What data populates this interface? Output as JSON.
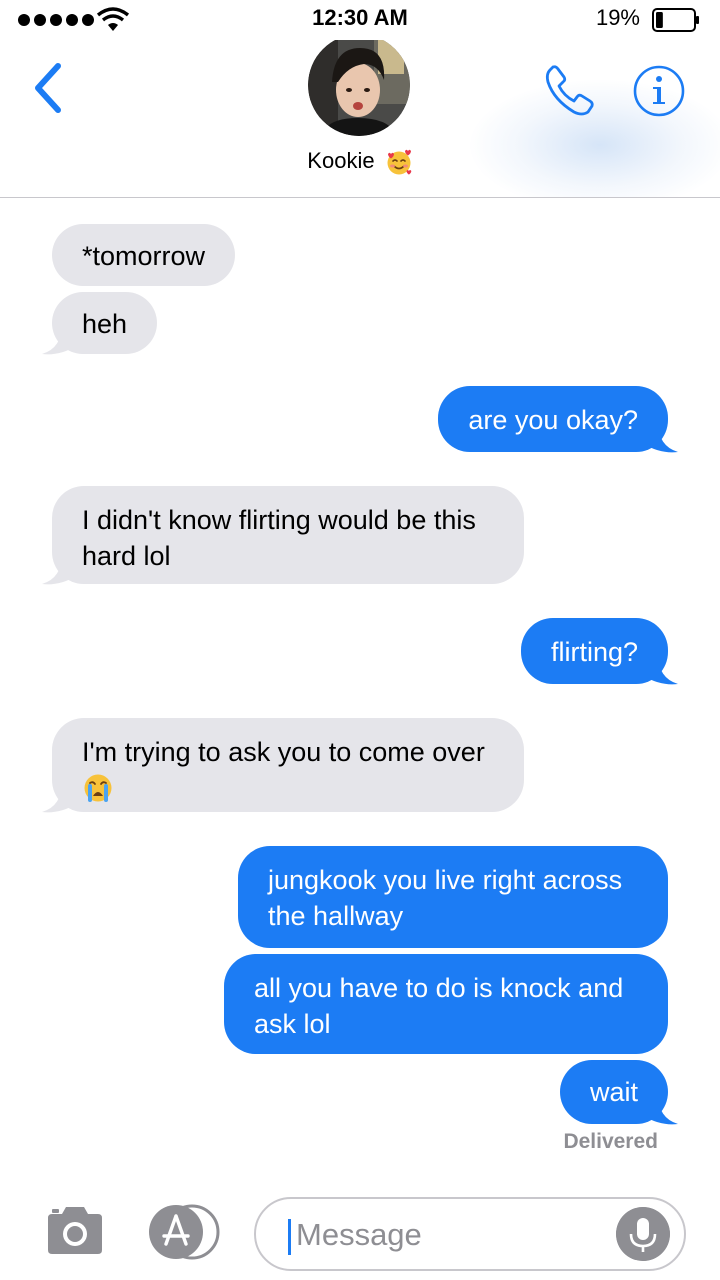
{
  "status_bar": {
    "time": "12:30 AM",
    "battery_percent": "19%",
    "battery_level": 0.19,
    "signal_bars": 5
  },
  "header": {
    "contact_name": "Kookie",
    "contact_emoji": "smiling-face-with-hearts-icon",
    "back_icon": "chevron-left-icon",
    "call_icon": "phone-icon",
    "info_icon": "info-icon"
  },
  "messages": [
    {
      "from": "them",
      "text": "*tomorrow"
    },
    {
      "from": "them",
      "text": "heh"
    },
    {
      "from": "me",
      "text": "are you okay?"
    },
    {
      "from": "them",
      "text": "I didn't know flirting would be this\nhard lol"
    },
    {
      "from": "me",
      "text": "flirting?"
    },
    {
      "from": "them",
      "text": "I'm trying to ask you to come over",
      "emoji": "crying-face-icon"
    },
    {
      "from": "me",
      "text": "jungkook you live right across\nthe hallway"
    },
    {
      "from": "me",
      "text": "all you have to do is knock and\nask lol"
    },
    {
      "from": "me",
      "text": "wait"
    }
  ],
  "delivery_status": "Delivered",
  "input": {
    "placeholder": "Message",
    "camera_icon": "camera-icon",
    "apps_icon": "app-store-icon",
    "mic_icon": "microphone-icon"
  },
  "colors": {
    "accent": "#1c7cf4",
    "incoming_bubble": "#e5e5ea",
    "outgoing_bubble": "#1c7cf4",
    "secondary_text": "#8e8e93"
  }
}
